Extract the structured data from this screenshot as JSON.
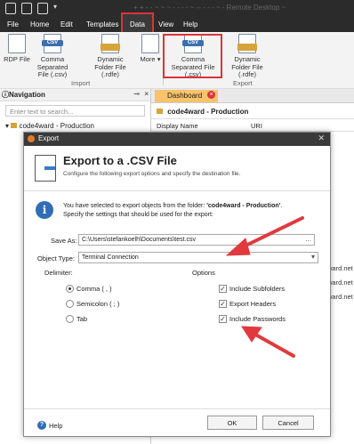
{
  "titlebar": {
    "bg_text": "+ + - - ~ ~ ~ - -  - - ~ -- - - - ~ - Remote Desktop ~"
  },
  "menu": {
    "file": "File",
    "home": "Home",
    "edit": "Edit",
    "templates": "Templates",
    "data": "Data",
    "view": "View",
    "help": "Help"
  },
  "ribbon": {
    "rdp": "RDP File",
    "csv1": "Comma Separated File (.csv)",
    "dyn1": "Dynamic Folder File (.rdfe)",
    "more": "More",
    "import_group": "Import",
    "csv2": "Comma Separated File (.csv)",
    "dyn2": "Dynamic Folder File (.rdfe)",
    "export_group": "Export"
  },
  "nav": {
    "title": "Navigation",
    "search_placeholder": "Enter text to search...",
    "root": "code4ward - Production"
  },
  "dashboard": {
    "tab": "Dashboard",
    "heading": "code4ward - Production",
    "col1": "Display Name",
    "col2": "URI",
    "rows": [
      "ward.net",
      "ward.net",
      "ward.net"
    ]
  },
  "dialog": {
    "title": "Export",
    "heading": "Export to a .CSV File",
    "subheading": "Configure the following export options and specify the destination file.",
    "info_line1_pre": "You have selected to export objects from the folder: ",
    "info_folder": "'code4ward - Production'",
    "info_line1_post": ".",
    "info_line2": "Specify the settings that should be used for the export:",
    "save_as_label": "Save As:",
    "save_as_value": "C:\\Users\\stefankoelh\\Documents\\test.csv",
    "save_as_button": "...",
    "object_type_label": "Object Type:",
    "object_type_value": "Terminal Connection",
    "delimiter_label": "Delimiter:",
    "delimiters": [
      {
        "label": "Comma ( , )",
        "selected": true
      },
      {
        "label": "Semicolon ( ; )",
        "selected": false
      },
      {
        "label": "Tab",
        "selected": false
      }
    ],
    "options_label": "Options",
    "options": [
      {
        "label": "Include Subfolders",
        "checked": true
      },
      {
        "label": "Export Headers",
        "checked": true
      },
      {
        "label": "Include Passwords",
        "checked": true
      }
    ],
    "help": "Help",
    "ok": "OK",
    "cancel": "Cancel"
  },
  "colors": {
    "highlight_red": "#d9343b",
    "arrow_red": "#e03a3e",
    "accent_blue": "#2f6db5",
    "dark_chrome": "#2b2b2b"
  }
}
